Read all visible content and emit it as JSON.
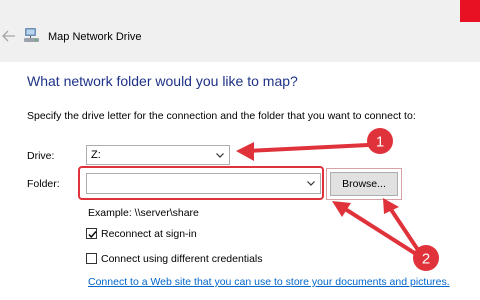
{
  "window": {
    "title": "Map Network Drive",
    "back_icon": "back-arrow-icon",
    "app_icon": "network-drive-icon"
  },
  "dialog": {
    "heading": "What network folder would you like to map?",
    "instruction": "Specify the drive letter for the connection and the folder that you want to connect to:"
  },
  "drive": {
    "label": "Drive:",
    "value": "Z:"
  },
  "folder": {
    "label": "Folder:",
    "value": "",
    "browse_label": "Browse...",
    "example": "Example: \\\\server\\share"
  },
  "options": {
    "reconnect": {
      "label": "Reconnect at sign-in",
      "checked": true
    },
    "credentials": {
      "label": "Connect using different credentials",
      "checked": false
    }
  },
  "link": {
    "text": "Connect to a Web site that you can use to store your documents and pictures."
  },
  "annotations": {
    "badge_1": "1",
    "badge_2": "2",
    "color": "#e0323a"
  }
}
